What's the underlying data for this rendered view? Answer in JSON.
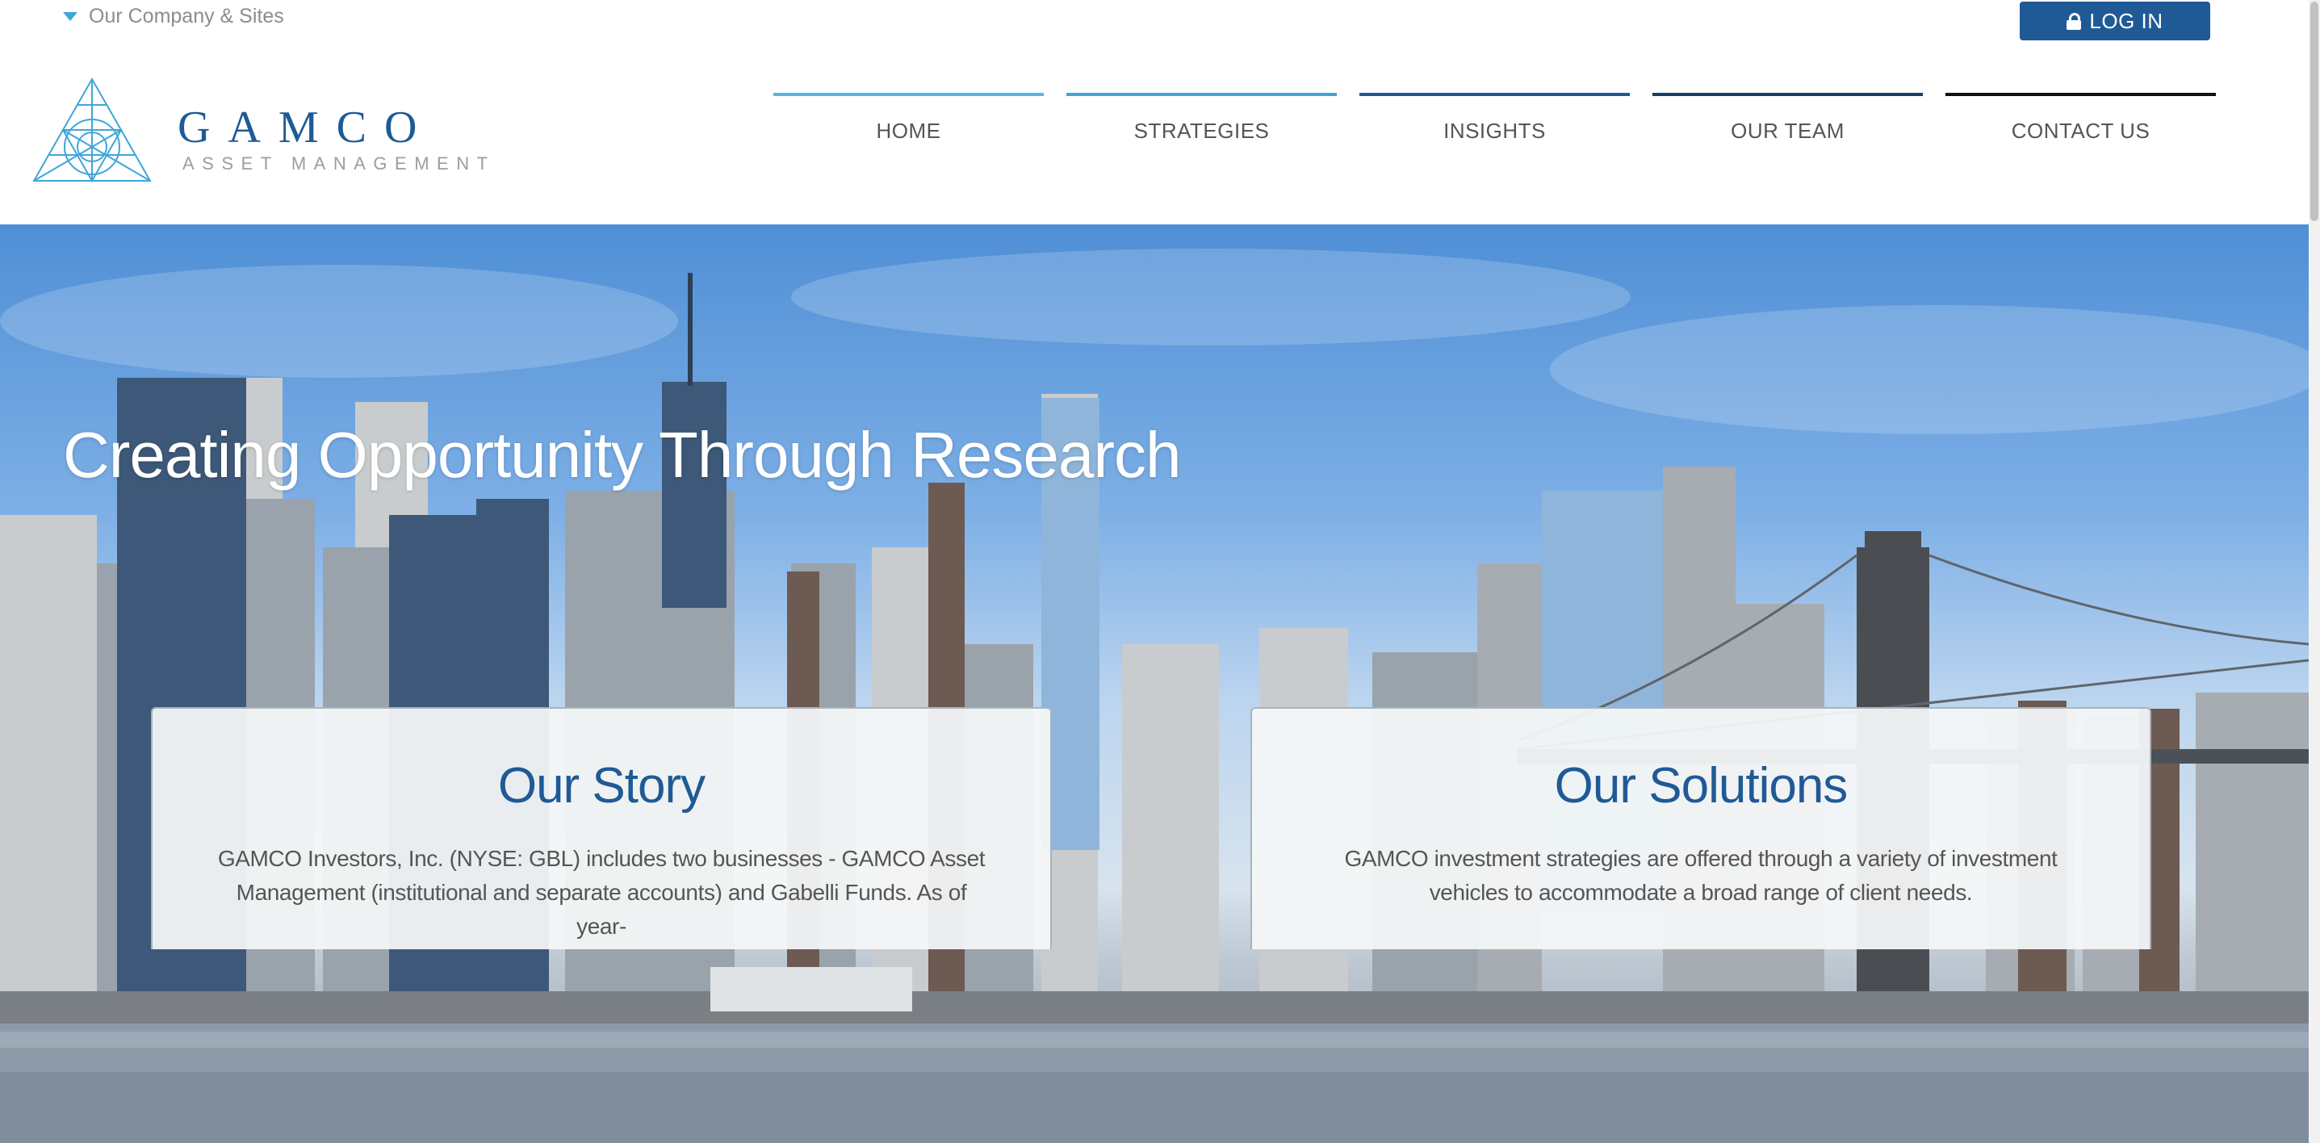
{
  "topbar": {
    "company_sites_label": "Our Company & Sites",
    "login_label": "LOG IN"
  },
  "logo": {
    "wordmark": "GAMCO",
    "tagline": "ASSET MANAGEMENT"
  },
  "nav": {
    "items": [
      {
        "label": "HOME"
      },
      {
        "label": "STRATEGIES"
      },
      {
        "label": "INSIGHTS"
      },
      {
        "label": "OUR TEAM"
      },
      {
        "label": "CONTACT US"
      }
    ]
  },
  "hero": {
    "headline": "Creating Opportunity Through Research"
  },
  "cards": {
    "story": {
      "title": "Our Story",
      "text": "GAMCO Investors, Inc. (NYSE: GBL) includes two businesses - GAMCO Asset Management (institutional and separate accounts) and Gabelli Funds. As of year-"
    },
    "solutions": {
      "title": "Our Solutions",
      "text": "GAMCO investment strategies are offered through a variety of investment vehicles to accommodate a broad range of client needs."
    }
  },
  "colors": {
    "brand_blue": "#1f5a96",
    "accent_light_blue": "#5ab4e3",
    "accent_mid_blue": "#3ea6d9"
  },
  "icons": {
    "dropdown": "triangle-down-icon",
    "login": "lock-icon",
    "logo_mark": "triangle-lattice-logo"
  }
}
